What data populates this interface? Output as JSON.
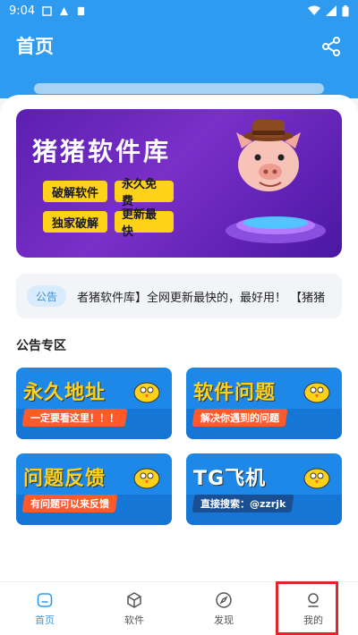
{
  "status_bar": {
    "time": "9:04"
  },
  "header": {
    "title": "首页"
  },
  "banner": {
    "title": "猪猪软件库",
    "tags": [
      "破解软件",
      "永久免费",
      "独家破解",
      "更新最快"
    ]
  },
  "notice": {
    "badge": "公告",
    "text": "者猪软件库】全网更新最快的，最好用！  【猪猪"
  },
  "section": {
    "title": "公告专区"
  },
  "cards": [
    {
      "title": "永久地址",
      "subtitle": "一定要看这里！！！"
    },
    {
      "title": "软件问题",
      "subtitle": "解决你遇到的问题"
    },
    {
      "title": "问题反馈",
      "subtitle": "有问题可以来反馈"
    },
    {
      "title": "TG飞机",
      "subtitle": "直接搜索：@zzrjk"
    }
  ],
  "nav": {
    "items": [
      {
        "label": "首页",
        "icon": "home-icon",
        "active": true
      },
      {
        "label": "软件",
        "icon": "cube-icon",
        "active": false
      },
      {
        "label": "发现",
        "icon": "compass-icon",
        "active": false
      },
      {
        "label": "我的",
        "icon": "user-icon",
        "active": false
      }
    ]
  },
  "colors": {
    "primary": "#2e9af0",
    "banner": "#5b1fb0",
    "tag": "#ffd21a",
    "highlight": "#e0262b"
  }
}
